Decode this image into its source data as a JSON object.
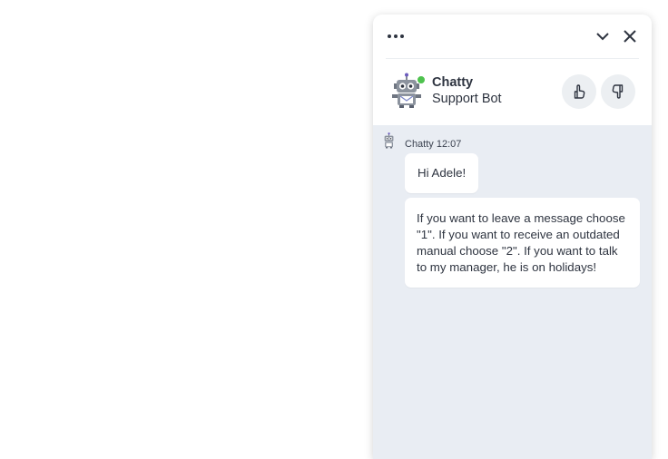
{
  "header": {
    "menu_icon": "ellipsis-icon",
    "minimize_icon": "chevron-down-icon",
    "close_icon": "close-icon"
  },
  "agent": {
    "name": "Chatty",
    "role": "Support Bot",
    "status": "online",
    "avatar_icon": "robot-icon",
    "rate_up_icon": "thumbs-up-icon",
    "rate_down_icon": "thumbs-down-icon"
  },
  "messages": [
    {
      "author": "Chatty",
      "time": "12:07",
      "meta": "Chatty 12:07",
      "texts": [
        "Hi Adele!",
        "If you want to leave a message choose \"1\". If you want to receive an outdated manual choose \"2\". If you want to talk to my manager, he is on holidays!"
      ]
    }
  ],
  "colors": {
    "background": "#ffffff",
    "chat_background": "#e9edf3",
    "text": "#2e3440",
    "online": "#4ec24e",
    "rate_button": "#eceff2"
  }
}
